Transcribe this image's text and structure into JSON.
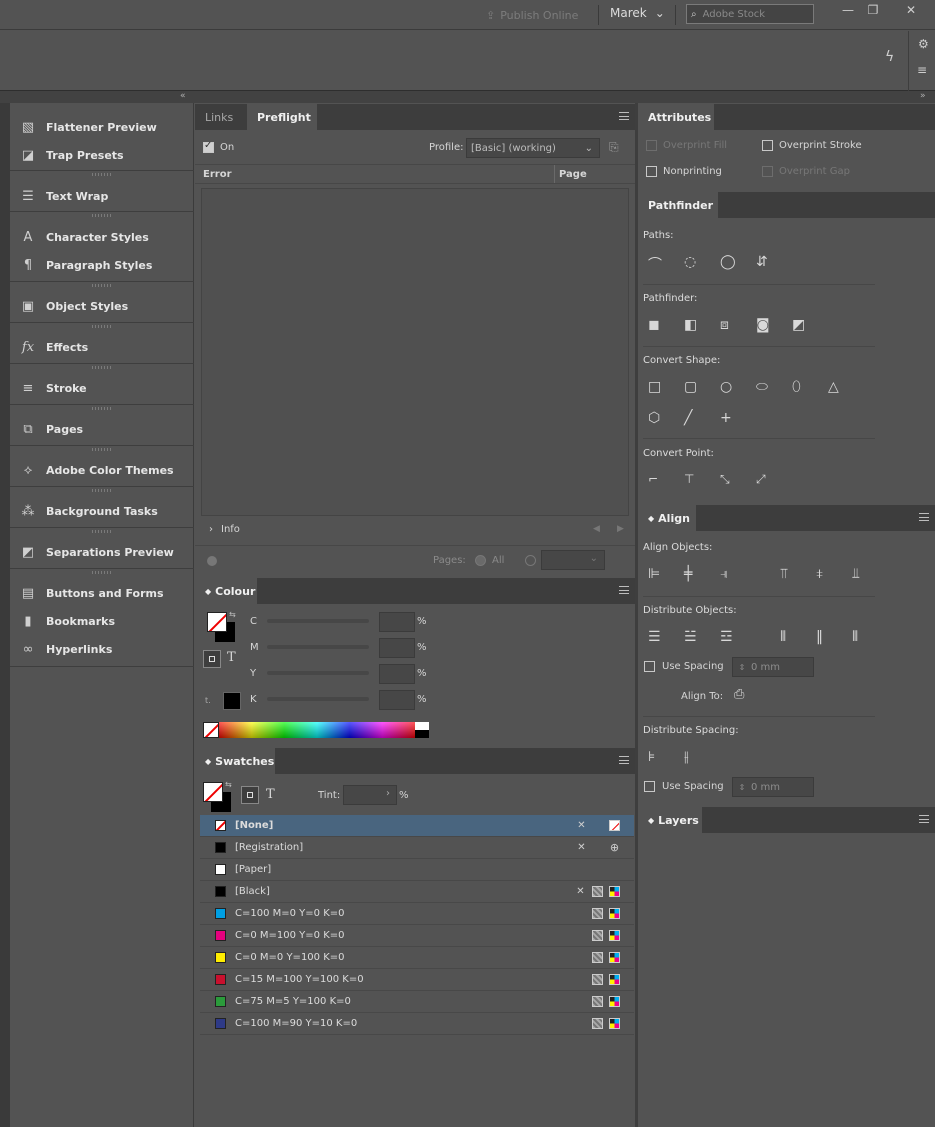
{
  "titlebar": {
    "publish_label": "Publish Online",
    "user_name": "Marek",
    "search_placeholder": "Adobe Stock",
    "minimize": "—",
    "restore": "❐",
    "close": "✕"
  },
  "icon_panels": [
    {
      "label": "Flattener Preview",
      "icon": "flattener-icon"
    },
    {
      "label": "Trap Presets",
      "icon": "trap-icon"
    },
    {
      "label": "Text Wrap",
      "icon": "text-wrap-icon"
    },
    {
      "label": "Character Styles",
      "icon": "character-styles-icon"
    },
    {
      "label": "Paragraph Styles",
      "icon": "paragraph-styles-icon"
    },
    {
      "label": "Object Styles",
      "icon": "object-styles-icon"
    },
    {
      "label": "Effects",
      "icon": "fx-icon"
    },
    {
      "label": "Stroke",
      "icon": "stroke-icon"
    },
    {
      "label": "Pages",
      "icon": "pages-icon"
    },
    {
      "label": "Adobe Color Themes",
      "icon": "color-themes-icon"
    },
    {
      "label": "Background Tasks",
      "icon": "background-tasks-icon"
    },
    {
      "label": "Separations Preview",
      "icon": "separations-icon"
    },
    {
      "label": "Buttons and Forms",
      "icon": "buttons-forms-icon"
    },
    {
      "label": "Bookmarks",
      "icon": "bookmark-icon"
    },
    {
      "label": "Hyperlinks",
      "icon": "hyperlinks-icon"
    }
  ],
  "preflight": {
    "tabs": [
      "Links",
      "Preflight"
    ],
    "on_label": "On",
    "profile_label": "Profile:",
    "profile_value": "[Basic] (working)",
    "col_error": "Error",
    "col_page": "Page",
    "info_label": "Info",
    "pages_label": "Pages:",
    "all_label": "All"
  },
  "colour": {
    "title": "Colour",
    "channels": [
      {
        "name": "C",
        "value": ""
      },
      {
        "name": "M",
        "value": ""
      },
      {
        "name": "Y",
        "value": ""
      },
      {
        "name": "K",
        "value": ""
      }
    ],
    "percent": "%",
    "text_glyph": "T"
  },
  "swatches": {
    "title": "Swatches",
    "tint_label": "Tint:",
    "tint_value": "",
    "percent": "%",
    "text_glyph": "T",
    "rows": [
      {
        "name": "[None]",
        "color": "#ffffff",
        "icons": [
          "pin",
          "none"
        ]
      },
      {
        "name": "[Registration]",
        "color": "#000000",
        "icons": [
          "pin",
          "reg"
        ]
      },
      {
        "name": "[Paper]",
        "color": "#ffffff",
        "icons": []
      },
      {
        "name": "[Black]",
        "color": "#000000",
        "icons": [
          "pin",
          "grid",
          "cmyk"
        ]
      },
      {
        "name": "C=100 M=0 Y=0 K=0",
        "color": "#009fe3",
        "icons": [
          "grid",
          "cmyk"
        ]
      },
      {
        "name": "C=0 M=100 Y=0 K=0",
        "color": "#e5007e",
        "icons": [
          "grid",
          "cmyk"
        ]
      },
      {
        "name": "C=0 M=0 Y=100 K=0",
        "color": "#ffed00",
        "icons": [
          "grid",
          "cmyk"
        ]
      },
      {
        "name": "C=15 M=100 Y=100 K=0",
        "color": "#c8102e",
        "icons": [
          "grid",
          "cmyk"
        ]
      },
      {
        "name": "C=75 M=5 Y=100 K=0",
        "color": "#2b9b3b",
        "icons": [
          "grid",
          "cmyk"
        ]
      },
      {
        "name": "C=100 M=90 Y=10 K=0",
        "color": "#2e3a87",
        "icons": [
          "grid",
          "cmyk"
        ]
      }
    ]
  },
  "attributes": {
    "title": "Attributes",
    "overprint_fill": "Overprint Fill",
    "overprint_stroke": "Overprint Stroke",
    "nonprinting": "Nonprinting",
    "overprint_gap": "Overprint Gap"
  },
  "pathfinder": {
    "title": "Pathfinder",
    "paths_label": "Paths:",
    "pathfinder_label": "Pathfinder:",
    "convert_shape_label": "Convert Shape:",
    "convert_point_label": "Convert Point:"
  },
  "align": {
    "title": "Align",
    "align_objects_label": "Align Objects:",
    "distribute_objects_label": "Distribute Objects:",
    "use_spacing_label": "Use Spacing",
    "spacing_value": "0 mm",
    "align_to_label": "Align To:",
    "distribute_spacing_label": "Distribute Spacing:",
    "use_spacing2_label": "Use Spacing",
    "spacing2_value": "0 mm"
  },
  "layers": {
    "title": "Layers"
  }
}
